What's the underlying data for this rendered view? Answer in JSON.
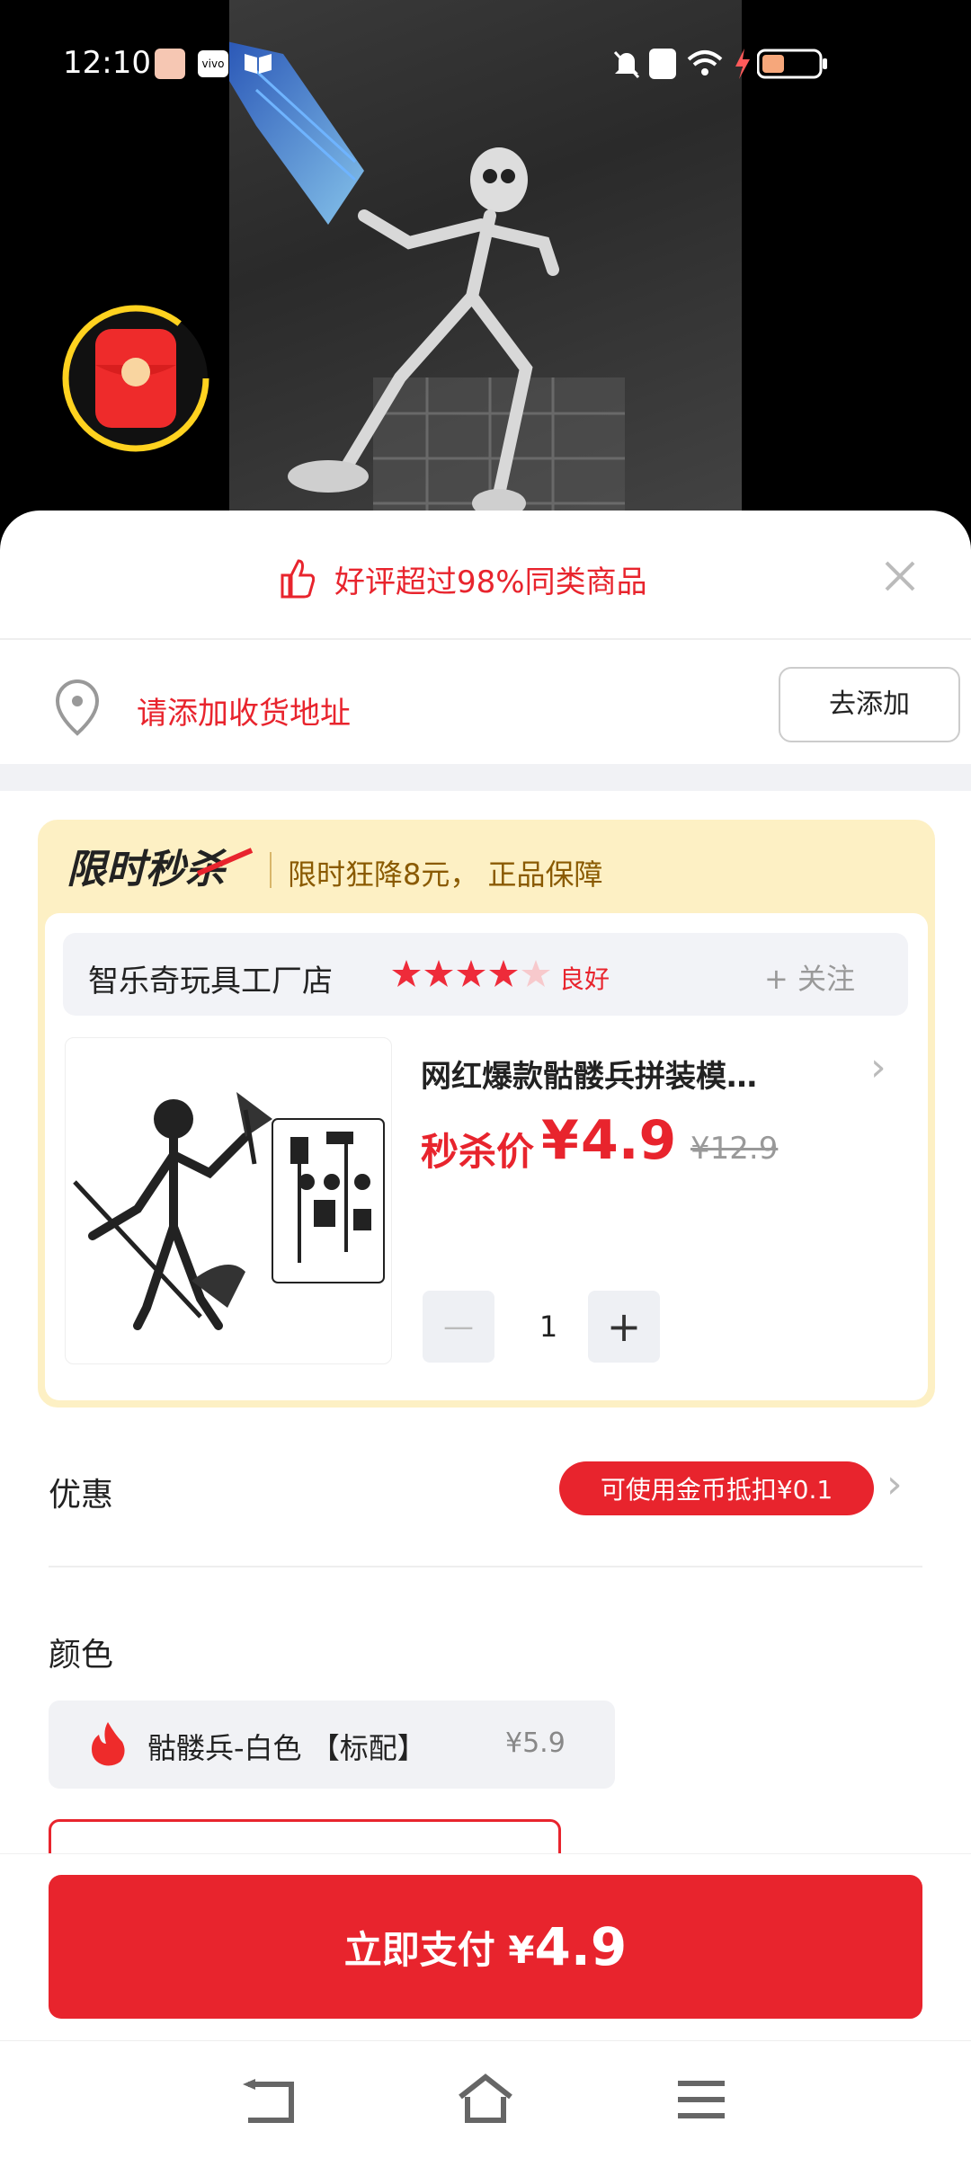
{
  "status_bar": {
    "time": "12:10",
    "carrier_badge": "vivo"
  },
  "header": {
    "rating_text": "好评超过98%同类商品"
  },
  "address": {
    "placeholder": "请添加收货地址",
    "add_button": "去添加"
  },
  "flash_sale": {
    "logo_text": "限时秒杀",
    "subtitle": "限时狂降8元， 正品保障"
  },
  "store": {
    "name": "智乐奇玩具工厂店",
    "rating_label": "良好",
    "stars_filled": 4,
    "stars_total": 5,
    "follow_label": "+ 关注"
  },
  "product": {
    "title": "网红爆款骷髅兵拼装模…",
    "price_label": "秒杀价",
    "currency": "¥",
    "price": "4.9",
    "original_price": "¥12.9",
    "quantity": "1",
    "minus": "—",
    "plus": "+"
  },
  "discount": {
    "label": "优惠",
    "coin_pill": "可使用金币抵扣¥0.1"
  },
  "color": {
    "label": "颜色",
    "option_name": "骷髅兵-白色 【标配】",
    "option_price": "¥5.9"
  },
  "pay": {
    "label": "立即支付 ¥",
    "amount": "4.9"
  },
  "colors": {
    "accent_red": "#e8242d",
    "flash_bg": "#fdf0c4",
    "gold_text": "#8a5a00"
  }
}
